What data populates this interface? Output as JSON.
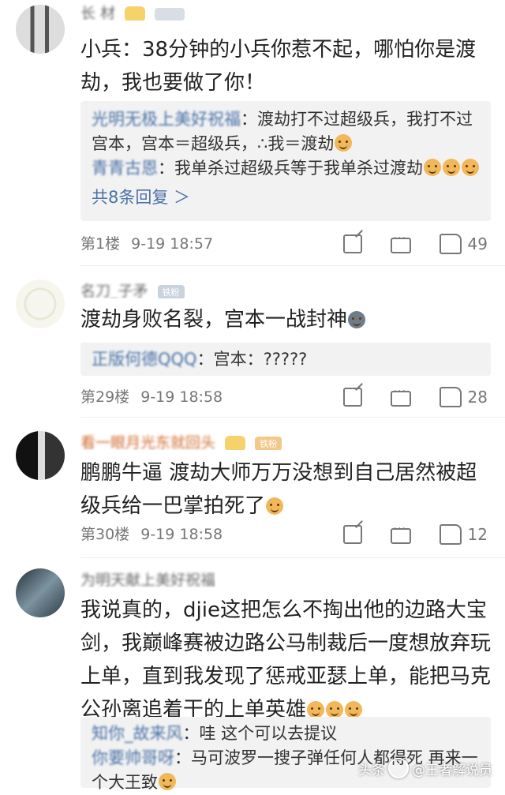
{
  "comments": [
    {
      "username": "长 材",
      "badge": "",
      "text": "小兵：38分钟的小兵你惹不起，哪怕你是渡劫，我也要做了你！",
      "replies": [
        {
          "name": "光明无极上美好祝福",
          "content": "渡劫打不过超级兵，我打不过宫本，宫本＝超级兵，∴我＝渡劫"
        },
        {
          "name": "青青古恩",
          "content": "我单杀过超级兵等于我单杀过渡劫"
        }
      ],
      "more_replies": "共8条回复 ＞",
      "floor": "第1楼",
      "time": "9-19 18:57",
      "likes": "49"
    },
    {
      "username": "名刀_子矛",
      "badge": "铁粉",
      "text": "渡劫身败名裂，宫本一战封神",
      "replies": [
        {
          "name": "正版何德QQQ",
          "content": "宫本：?????"
        }
      ],
      "floor": "第29楼",
      "time": "9-19 18:58",
      "likes": "28"
    },
    {
      "username": "看一眼月光东就回头",
      "badge": "铁粉",
      "text": "鹏鹏牛逼 渡劫大师万万没想到自己居然被超级兵给一巴掌拍死了",
      "floor": "第30楼",
      "time": "9-19 18:58",
      "likes": "12"
    },
    {
      "username": "为明天献上美好祝福",
      "badge": "",
      "text": "我说真的，djie这把怎么不掏出他的边路大宝剑，我巅峰赛被边路公马制裁后一度想放弃玩上单，直到我发现了惩戒亚瑟上单，能把马克公孙离追着干的上单英雄",
      "replies": [
        {
          "name": "知你_故来风",
          "content": "哇 这个可以去提议"
        },
        {
          "name": "你要帅哥呀",
          "content": "马可波罗一搜子弹任何人都得死 再来一个大王致"
        }
      ]
    }
  ],
  "watermark": {
    "prefix": "头条",
    "name": "@王者解说员"
  }
}
